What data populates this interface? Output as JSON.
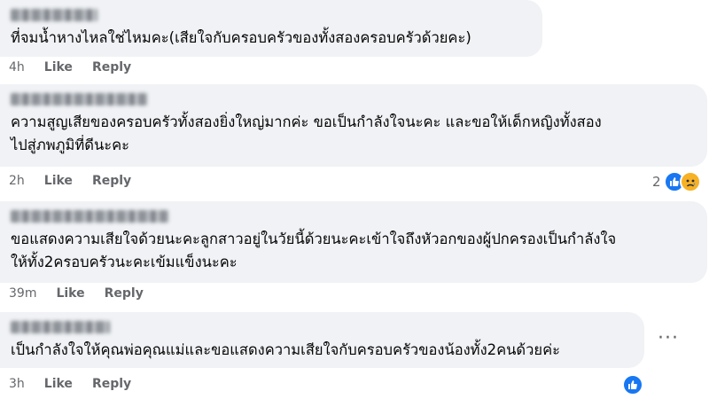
{
  "comments": [
    {
      "text": "ที่จมน้ำหางไหลใช่ไหมคะ(เสียใจกับครอบครัวของทั้งสองครอบครัวด้วยคะ)",
      "time": "4h",
      "like": "Like",
      "reply": "Reply"
    },
    {
      "text": "ความสูญเสียของครอบครัวทั้งสองยิ่งใหญ่มากค่ะ ขอเป็นกำลังใจนะคะ และขอให้เด็กหญิงทั้งสอง\nไปสู่ภพภูมิที่ดีนะคะ",
      "time": "2h",
      "like": "Like",
      "reply": "Reply",
      "reaction_count": "2",
      "reactions": [
        "like-icon",
        "sad-icon"
      ]
    },
    {
      "text": "ขอแสดงความเสียใจด้วยนะคะลูกสาวอยู่ในวัยนี้ด้วยนะคะเข้าใจถึงหัวอกของผู้ปกครองเป็นกำลังใจ\nให้ทั้ง2ครอบครัวนะคะเข้มแข็งนะคะ",
      "time": "39m",
      "like": "Like",
      "reply": "Reply"
    },
    {
      "text": "เป็นกำลังใจให้คุณพ่อคุณแม่และขอแสดงความเสียใจกับครอบครัวของน้องทั้ง2คนด้วยค่ะ",
      "time": "3h",
      "like": "Like",
      "reply": "Reply",
      "more": "···",
      "reactions": [
        "like-icon"
      ]
    }
  ],
  "colors": {
    "bubble": "#f0f2f5",
    "text": "#050505",
    "meta": "#65676b",
    "like": "#1877f2",
    "sad": "#f7b125"
  }
}
